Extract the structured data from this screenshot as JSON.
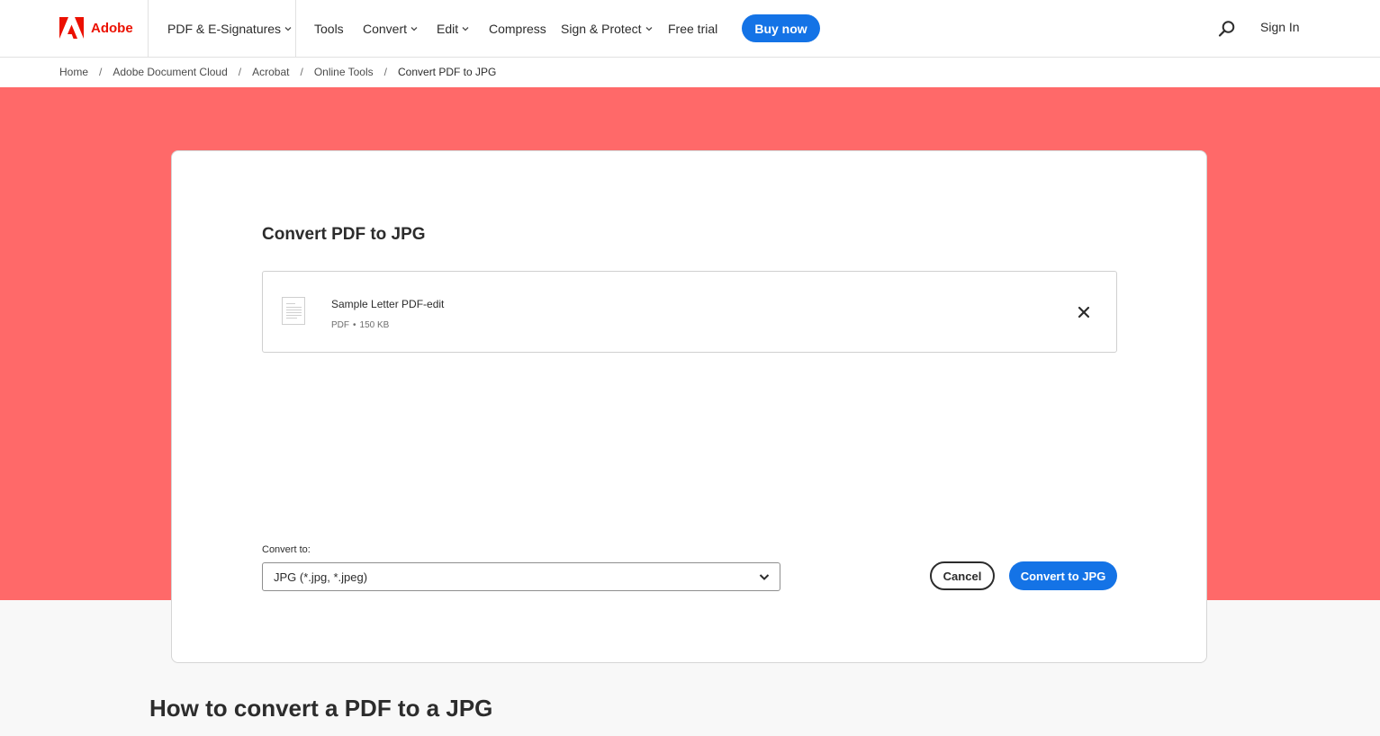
{
  "brand": {
    "name": "Adobe",
    "color": "#eb1000",
    "logo_icon": "adobe-logo-icon"
  },
  "nav": {
    "product_menu": "PDF & E-Signatures",
    "items": [
      {
        "label": "Tools",
        "has_dropdown": false
      },
      {
        "label": "Convert",
        "has_dropdown": true
      },
      {
        "label": "Edit",
        "has_dropdown": true
      },
      {
        "label": "Compress",
        "has_dropdown": false
      },
      {
        "label": "Sign & Protect",
        "has_dropdown": true
      },
      {
        "label": "Free trial",
        "has_dropdown": false
      }
    ],
    "buy_button": "Buy now",
    "search_icon": "search-icon",
    "sign_in": "Sign In"
  },
  "breadcrumb": {
    "items": [
      "Home",
      "Adobe Document Cloud",
      "Acrobat",
      "Online Tools",
      "Convert PDF to JPG"
    ],
    "separator": "/"
  },
  "card": {
    "title": "Convert PDF to JPG",
    "file": {
      "name": "Sample Letter PDF-edit",
      "type": "PDF",
      "dot": "•",
      "size": "150 KB",
      "remove_icon": "close-icon"
    },
    "convert_to_label": "Convert to:",
    "format_selected": "JPG (*.jpg, *.jpeg)",
    "cancel_button": "Cancel",
    "convert_button": "Convert to JPG"
  },
  "section_heading": "How to convert a PDF to a JPG",
  "colors": {
    "hero_bg": "#ff6969",
    "accent": "#1473e6",
    "brand_red": "#eb1000"
  }
}
